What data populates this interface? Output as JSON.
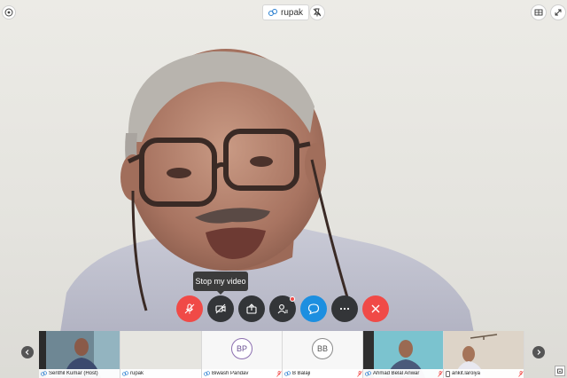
{
  "header": {
    "presenter_name": "rupak"
  },
  "tooltip": {
    "text": "Stop my video"
  },
  "controls": {
    "mute": "microphone-muted-icon",
    "video": "video-off-icon",
    "share": "share-icon",
    "participants": "participants-icon",
    "chat": "chat-icon",
    "more": "more-icon",
    "leave": "end-call-icon"
  },
  "colors": {
    "red": "#f04a47",
    "blue": "#1d8fe0",
    "dark": "#333538"
  },
  "participants": [
    {
      "name": "Senthil Kumar (Host)",
      "initials": "",
      "type": "video"
    },
    {
      "name": "rupak",
      "initials": "",
      "type": "video-self"
    },
    {
      "name": "Biwash Pandav",
      "initials": "BP",
      "type": "avatar"
    },
    {
      "name": "B Balaji",
      "initials": "BB",
      "type": "avatar"
    },
    {
      "name": "Ahmad Belal Anwar",
      "initials": "",
      "type": "video"
    },
    {
      "name": "ankit.laroiya",
      "initials": "",
      "type": "video"
    }
  ]
}
